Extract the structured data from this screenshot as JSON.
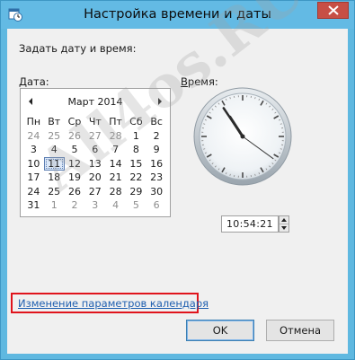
{
  "window": {
    "title": "Настройка времени и даты",
    "icon": "calendar-clock-icon",
    "close_icon": "close-icon"
  },
  "main": {
    "prompt": "Задать дату и время:",
    "date_label": "Дата:",
    "time_label": "Время:"
  },
  "calendar": {
    "prev_icon": "triangle-left-icon",
    "next_icon": "triangle-right-icon",
    "month_title": "Март 2014",
    "weekdays": [
      "Пн",
      "Вт",
      "Ср",
      "Чт",
      "Пт",
      "Сб",
      "Вс"
    ],
    "weeks": [
      [
        {
          "d": "24",
          "cur": false
        },
        {
          "d": "25",
          "cur": false
        },
        {
          "d": "26",
          "cur": false
        },
        {
          "d": "27",
          "cur": false
        },
        {
          "d": "28",
          "cur": false
        },
        {
          "d": "1",
          "cur": true
        },
        {
          "d": "2",
          "cur": true
        }
      ],
      [
        {
          "d": "3",
          "cur": true
        },
        {
          "d": "4",
          "cur": true
        },
        {
          "d": "5",
          "cur": true
        },
        {
          "d": "6",
          "cur": true
        },
        {
          "d": "7",
          "cur": true
        },
        {
          "d": "8",
          "cur": true
        },
        {
          "d": "9",
          "cur": true
        }
      ],
      [
        {
          "d": "10",
          "cur": true
        },
        {
          "d": "11",
          "cur": true,
          "selected": true
        },
        {
          "d": "12",
          "cur": true
        },
        {
          "d": "13",
          "cur": true
        },
        {
          "d": "14",
          "cur": true
        },
        {
          "d": "15",
          "cur": true
        },
        {
          "d": "16",
          "cur": true
        }
      ],
      [
        {
          "d": "17",
          "cur": true
        },
        {
          "d": "18",
          "cur": true
        },
        {
          "d": "19",
          "cur": true
        },
        {
          "d": "20",
          "cur": true
        },
        {
          "d": "21",
          "cur": true
        },
        {
          "d": "22",
          "cur": true
        },
        {
          "d": "23",
          "cur": true
        }
      ],
      [
        {
          "d": "24",
          "cur": true
        },
        {
          "d": "25",
          "cur": true
        },
        {
          "d": "26",
          "cur": true
        },
        {
          "d": "27",
          "cur": true
        },
        {
          "d": "28",
          "cur": true
        },
        {
          "d": "29",
          "cur": true
        },
        {
          "d": "30",
          "cur": true
        }
      ],
      [
        {
          "d": "31",
          "cur": true
        },
        {
          "d": "1",
          "cur": false
        },
        {
          "d": "2",
          "cur": false
        },
        {
          "d": "3",
          "cur": false
        },
        {
          "d": "4",
          "cur": false
        },
        {
          "d": "5",
          "cur": false
        },
        {
          "d": "6",
          "cur": false
        }
      ]
    ]
  },
  "clock": {
    "hours": 10,
    "minutes": 54,
    "seconds": 21
  },
  "time_field": {
    "hh": "10",
    "mm": "54",
    "ss": "21",
    "sep": ":",
    "spin_up_icon": "arrow-up-icon",
    "spin_down_icon": "arrow-down-icon"
  },
  "link": {
    "text": "Изменение параметров календаря"
  },
  "buttons": {
    "ok": "OK",
    "cancel": "Отмена"
  },
  "watermark": {
    "text": "All4os.RU"
  }
}
